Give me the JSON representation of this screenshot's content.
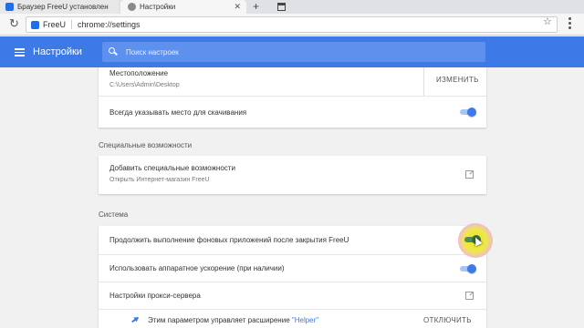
{
  "tabs": [
    {
      "title": "Браузер FreeU установлен",
      "active": false
    },
    {
      "title": "Настройки",
      "active": true
    }
  ],
  "address_bar": {
    "site_label": "FreeU",
    "url": "chrome://settings"
  },
  "header": {
    "title": "Настройки",
    "search_placeholder": "Поиск настроек",
    "accent_color": "#3e7ae7"
  },
  "downloads": {
    "location_label": "Местоположение",
    "location_path": "C:\\Users\\Admin\\Desktop",
    "change_button": "ИЗМЕНИТЬ",
    "ask_where_label": "Всегда указывать место для скачивания",
    "ask_where_enabled": true
  },
  "accessibility": {
    "section_title": "Специальные возможности",
    "add_features_label": "Добавить специальные возможности",
    "add_features_sub": "Открыть Интернет-магазин FreeU"
  },
  "system": {
    "section_title": "Система",
    "background_apps_label": "Продолжить выполнение фоновых приложений после закрытия FreeU",
    "background_apps_enabled": true,
    "hardware_accel_label": "Использовать аппаратное ускорение (при наличии)",
    "hardware_accel_enabled": true,
    "proxy_label": "Настройки прокси-сервера",
    "extension_notice_prefix": "Этим параметром управляет расширение ",
    "extension_name": "\"Helper\"",
    "disable_button": "ОТКЛЮЧИТЬ"
  }
}
